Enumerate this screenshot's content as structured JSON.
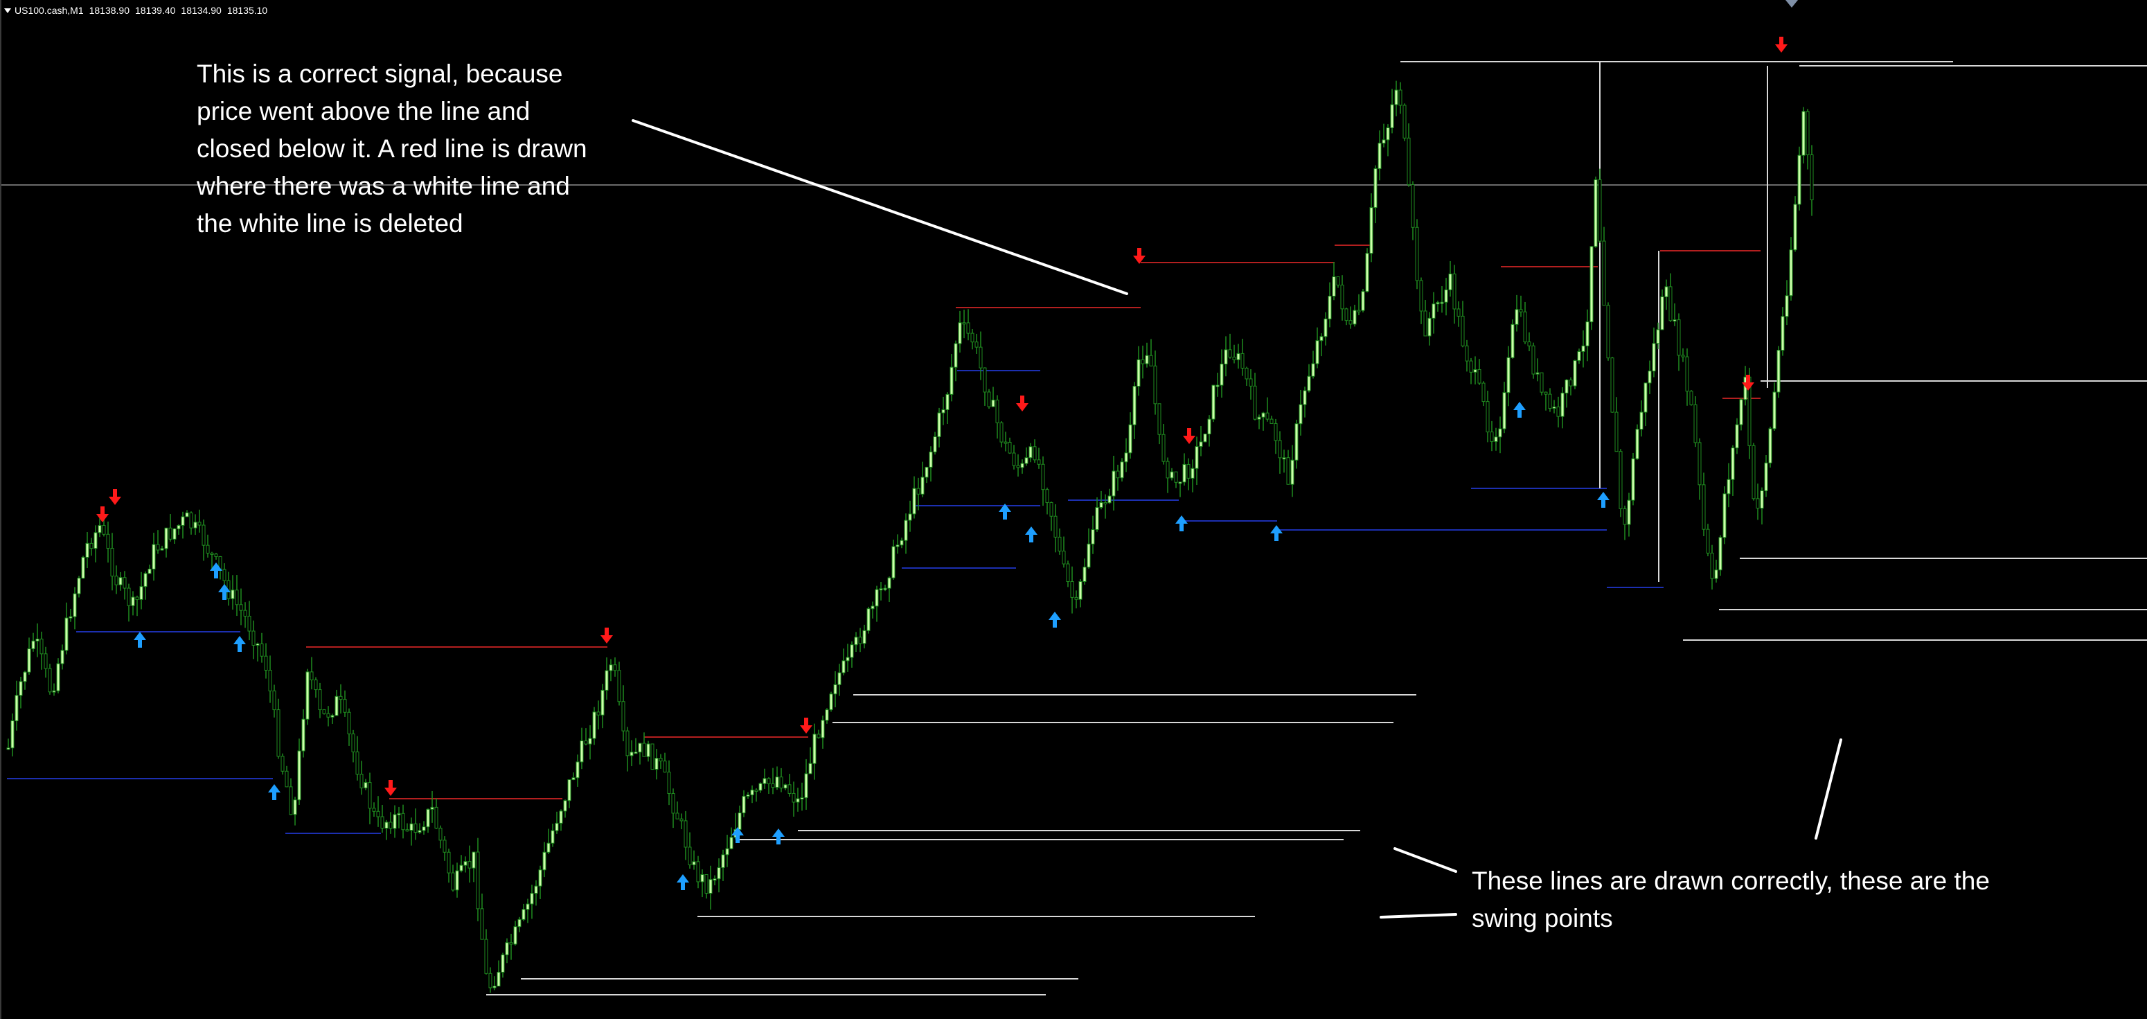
{
  "header": {
    "symbol": "US100.cash,M1",
    "open": "18138.90",
    "high": "18139.40",
    "low": "18134.90",
    "close": "18135.10"
  },
  "annotations": {
    "signal_lines": [
      "This is a correct signal, because",
      "price went above the line and",
      "closed below it. A red line is drawn",
      "where there was a white line and",
      "the white line is deleted"
    ],
    "swing_lines": [
      "These lines are drawn correctly, these are the",
      "swing points"
    ]
  },
  "colors": {
    "background": "#000000",
    "candle_body": "#ccffaa",
    "candle_outline": "#1f8c1f",
    "sell_arrow": "#ff1a1a",
    "buy_arrow": "#1e9fff",
    "swing_high_broken_line": "#b31f1f",
    "swing_low_line": "#1c2fb0",
    "swing_unbroken_line": "#d8d8d8",
    "bid_line": "#6b6b6b",
    "annotation_text": "#ffffff"
  },
  "icons": {
    "sell_signal": "red-down-arrow-icon",
    "buy_signal": "blue-up-arrow-icon"
  }
}
